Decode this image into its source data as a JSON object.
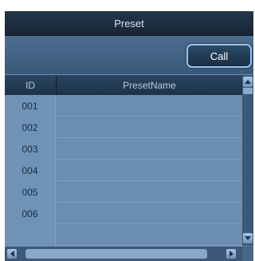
{
  "panel": {
    "title": "Preset"
  },
  "toolbar": {
    "call_label": "Call"
  },
  "table": {
    "columns": {
      "id": "ID",
      "name": "PresetName"
    },
    "rows": [
      {
        "id": "001",
        "name": ""
      },
      {
        "id": "002",
        "name": ""
      },
      {
        "id": "003",
        "name": ""
      },
      {
        "id": "004",
        "name": ""
      },
      {
        "id": "005",
        "name": ""
      },
      {
        "id": "006",
        "name": ""
      },
      {
        "id": "",
        "name": ""
      }
    ]
  },
  "icons": {
    "scroll_up": "arrow-up-icon",
    "scroll_down": "arrow-down-icon",
    "scroll_left": "arrow-left-icon",
    "scroll_right": "arrow-right-icon"
  },
  "colors": {
    "title_bar": "#1c2d3f",
    "panel_bg": "#6a8db0",
    "button_border": "#9cc4ea",
    "header_bg": "#223a54"
  }
}
